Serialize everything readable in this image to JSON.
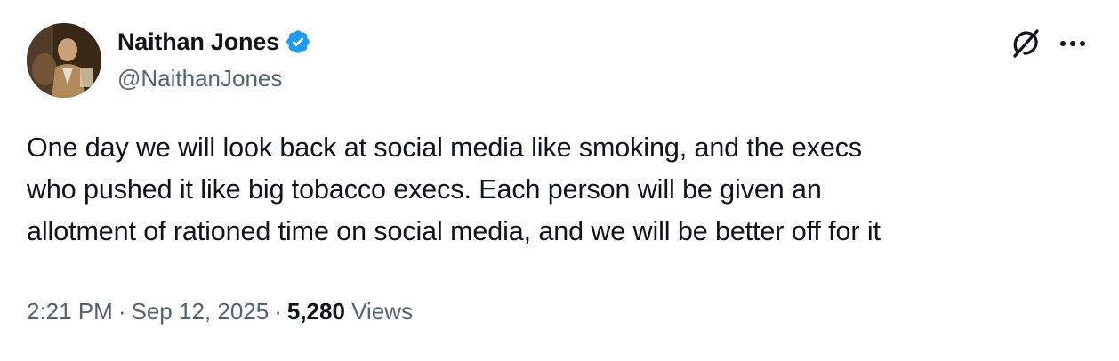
{
  "author": {
    "display_name": "Naithan Jones",
    "handle": "@NaithanJones",
    "verified": true,
    "verified_color": "#1d9bf0"
  },
  "tweet": {
    "lines": [
      "One day we will look back at social media like smoking, and the execs",
      "who pushed it like big tobacco execs. Each person will be given an",
      "allotment of rationed time on social media, and we will be better off for it"
    ]
  },
  "meta": {
    "time": "2:21 PM",
    "separator": "·",
    "date": "Sep 12, 2025",
    "views_count": "5,280",
    "views_label": "Views"
  },
  "icons": {
    "grok": "grok-icon",
    "more": "more-icon",
    "verified": "verified-badge-icon"
  },
  "colors": {
    "text_primary": "#0f1419",
    "text_secondary": "#536471",
    "accent": "#1d9bf0"
  }
}
